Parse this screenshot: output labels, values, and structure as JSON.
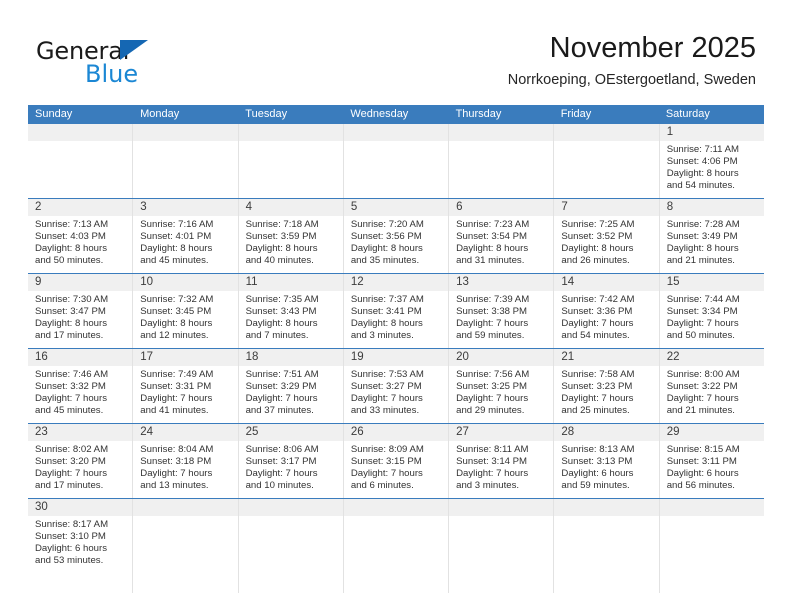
{
  "brand": {
    "name_top": "General",
    "name_bottom": "Blue",
    "accent_dark_blue": "#1567b3",
    "accent_light_blue": "#1b87d4"
  },
  "header": {
    "title": "November 2025",
    "subtitle": "Norrkoeping, OEstergoetland, Sweden"
  },
  "theme": {
    "header_blue": "#3a7cbd",
    "band_gray": "#f0f0f0",
    "cell_border": "#e2e2e2",
    "text": "#333333"
  },
  "calendar": {
    "weekday_headers": [
      "Sunday",
      "Monday",
      "Tuesday",
      "Wednesday",
      "Thursday",
      "Friday",
      "Saturday"
    ],
    "weeks": [
      [
        {
          "date": "",
          "lines": [
            "",
            "",
            "",
            ""
          ]
        },
        {
          "date": "",
          "lines": [
            "",
            "",
            "",
            ""
          ]
        },
        {
          "date": "",
          "lines": [
            "",
            "",
            "",
            ""
          ]
        },
        {
          "date": "",
          "lines": [
            "",
            "",
            "",
            ""
          ]
        },
        {
          "date": "",
          "lines": [
            "",
            "",
            "",
            ""
          ]
        },
        {
          "date": "",
          "lines": [
            "",
            "",
            "",
            ""
          ]
        },
        {
          "date": "1",
          "lines": [
            "Sunrise: 7:11 AM",
            "Sunset: 4:06 PM",
            "Daylight: 8 hours",
            "and 54 minutes."
          ]
        }
      ],
      [
        {
          "date": "2",
          "lines": [
            "Sunrise: 7:13 AM",
            "Sunset: 4:03 PM",
            "Daylight: 8 hours",
            "and 50 minutes."
          ]
        },
        {
          "date": "3",
          "lines": [
            "Sunrise: 7:16 AM",
            "Sunset: 4:01 PM",
            "Daylight: 8 hours",
            "and 45 minutes."
          ]
        },
        {
          "date": "4",
          "lines": [
            "Sunrise: 7:18 AM",
            "Sunset: 3:59 PM",
            "Daylight: 8 hours",
            "and 40 minutes."
          ]
        },
        {
          "date": "5",
          "lines": [
            "Sunrise: 7:20 AM",
            "Sunset: 3:56 PM",
            "Daylight: 8 hours",
            "and 35 minutes."
          ]
        },
        {
          "date": "6",
          "lines": [
            "Sunrise: 7:23 AM",
            "Sunset: 3:54 PM",
            "Daylight: 8 hours",
            "and 31 minutes."
          ]
        },
        {
          "date": "7",
          "lines": [
            "Sunrise: 7:25 AM",
            "Sunset: 3:52 PM",
            "Daylight: 8 hours",
            "and 26 minutes."
          ]
        },
        {
          "date": "8",
          "lines": [
            "Sunrise: 7:28 AM",
            "Sunset: 3:49 PM",
            "Daylight: 8 hours",
            "and 21 minutes."
          ]
        }
      ],
      [
        {
          "date": "9",
          "lines": [
            "Sunrise: 7:30 AM",
            "Sunset: 3:47 PM",
            "Daylight: 8 hours",
            "and 17 minutes."
          ]
        },
        {
          "date": "10",
          "lines": [
            "Sunrise: 7:32 AM",
            "Sunset: 3:45 PM",
            "Daylight: 8 hours",
            "and 12 minutes."
          ]
        },
        {
          "date": "11",
          "lines": [
            "Sunrise: 7:35 AM",
            "Sunset: 3:43 PM",
            "Daylight: 8 hours",
            "and 7 minutes."
          ]
        },
        {
          "date": "12",
          "lines": [
            "Sunrise: 7:37 AM",
            "Sunset: 3:41 PM",
            "Daylight: 8 hours",
            "and 3 minutes."
          ]
        },
        {
          "date": "13",
          "lines": [
            "Sunrise: 7:39 AM",
            "Sunset: 3:38 PM",
            "Daylight: 7 hours",
            "and 59 minutes."
          ]
        },
        {
          "date": "14",
          "lines": [
            "Sunrise: 7:42 AM",
            "Sunset: 3:36 PM",
            "Daylight: 7 hours",
            "and 54 minutes."
          ]
        },
        {
          "date": "15",
          "lines": [
            "Sunrise: 7:44 AM",
            "Sunset: 3:34 PM",
            "Daylight: 7 hours",
            "and 50 minutes."
          ]
        }
      ],
      [
        {
          "date": "16",
          "lines": [
            "Sunrise: 7:46 AM",
            "Sunset: 3:32 PM",
            "Daylight: 7 hours",
            "and 45 minutes."
          ]
        },
        {
          "date": "17",
          "lines": [
            "Sunrise: 7:49 AM",
            "Sunset: 3:31 PM",
            "Daylight: 7 hours",
            "and 41 minutes."
          ]
        },
        {
          "date": "18",
          "lines": [
            "Sunrise: 7:51 AM",
            "Sunset: 3:29 PM",
            "Daylight: 7 hours",
            "and 37 minutes."
          ]
        },
        {
          "date": "19",
          "lines": [
            "Sunrise: 7:53 AM",
            "Sunset: 3:27 PM",
            "Daylight: 7 hours",
            "and 33 minutes."
          ]
        },
        {
          "date": "20",
          "lines": [
            "Sunrise: 7:56 AM",
            "Sunset: 3:25 PM",
            "Daylight: 7 hours",
            "and 29 minutes."
          ]
        },
        {
          "date": "21",
          "lines": [
            "Sunrise: 7:58 AM",
            "Sunset: 3:23 PM",
            "Daylight: 7 hours",
            "and 25 minutes."
          ]
        },
        {
          "date": "22",
          "lines": [
            "Sunrise: 8:00 AM",
            "Sunset: 3:22 PM",
            "Daylight: 7 hours",
            "and 21 minutes."
          ]
        }
      ],
      [
        {
          "date": "23",
          "lines": [
            "Sunrise: 8:02 AM",
            "Sunset: 3:20 PM",
            "Daylight: 7 hours",
            "and 17 minutes."
          ]
        },
        {
          "date": "24",
          "lines": [
            "Sunrise: 8:04 AM",
            "Sunset: 3:18 PM",
            "Daylight: 7 hours",
            "and 13 minutes."
          ]
        },
        {
          "date": "25",
          "lines": [
            "Sunrise: 8:06 AM",
            "Sunset: 3:17 PM",
            "Daylight: 7 hours",
            "and 10 minutes."
          ]
        },
        {
          "date": "26",
          "lines": [
            "Sunrise: 8:09 AM",
            "Sunset: 3:15 PM",
            "Daylight: 7 hours",
            "and 6 minutes."
          ]
        },
        {
          "date": "27",
          "lines": [
            "Sunrise: 8:11 AM",
            "Sunset: 3:14 PM",
            "Daylight: 7 hours",
            "and 3 minutes."
          ]
        },
        {
          "date": "28",
          "lines": [
            "Sunrise: 8:13 AM",
            "Sunset: 3:13 PM",
            "Daylight: 6 hours",
            "and 59 minutes."
          ]
        },
        {
          "date": "29",
          "lines": [
            "Sunrise: 8:15 AM",
            "Sunset: 3:11 PM",
            "Daylight: 6 hours",
            "and 56 minutes."
          ]
        }
      ],
      [
        {
          "date": "30",
          "lines": [
            "Sunrise: 8:17 AM",
            "Sunset: 3:10 PM",
            "Daylight: 6 hours",
            "and 53 minutes."
          ]
        },
        {
          "date": "",
          "lines": [
            "",
            "",
            "",
            ""
          ]
        },
        {
          "date": "",
          "lines": [
            "",
            "",
            "",
            ""
          ]
        },
        {
          "date": "",
          "lines": [
            "",
            "",
            "",
            ""
          ]
        },
        {
          "date": "",
          "lines": [
            "",
            "",
            "",
            ""
          ]
        },
        {
          "date": "",
          "lines": [
            "",
            "",
            "",
            ""
          ]
        },
        {
          "date": "",
          "lines": [
            "",
            "",
            "",
            ""
          ]
        }
      ]
    ]
  }
}
